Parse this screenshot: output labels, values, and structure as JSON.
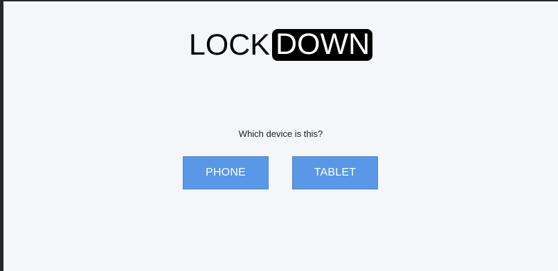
{
  "logo": {
    "part1": "LOCK",
    "part2": "DOWN"
  },
  "prompt": "Which device is this?",
  "buttons": {
    "phone": "PHONE",
    "tablet": "TABLET"
  },
  "colors": {
    "page_background": "#f5f6f9",
    "button_background": "#5898e6",
    "logo_badge": "#000000"
  }
}
